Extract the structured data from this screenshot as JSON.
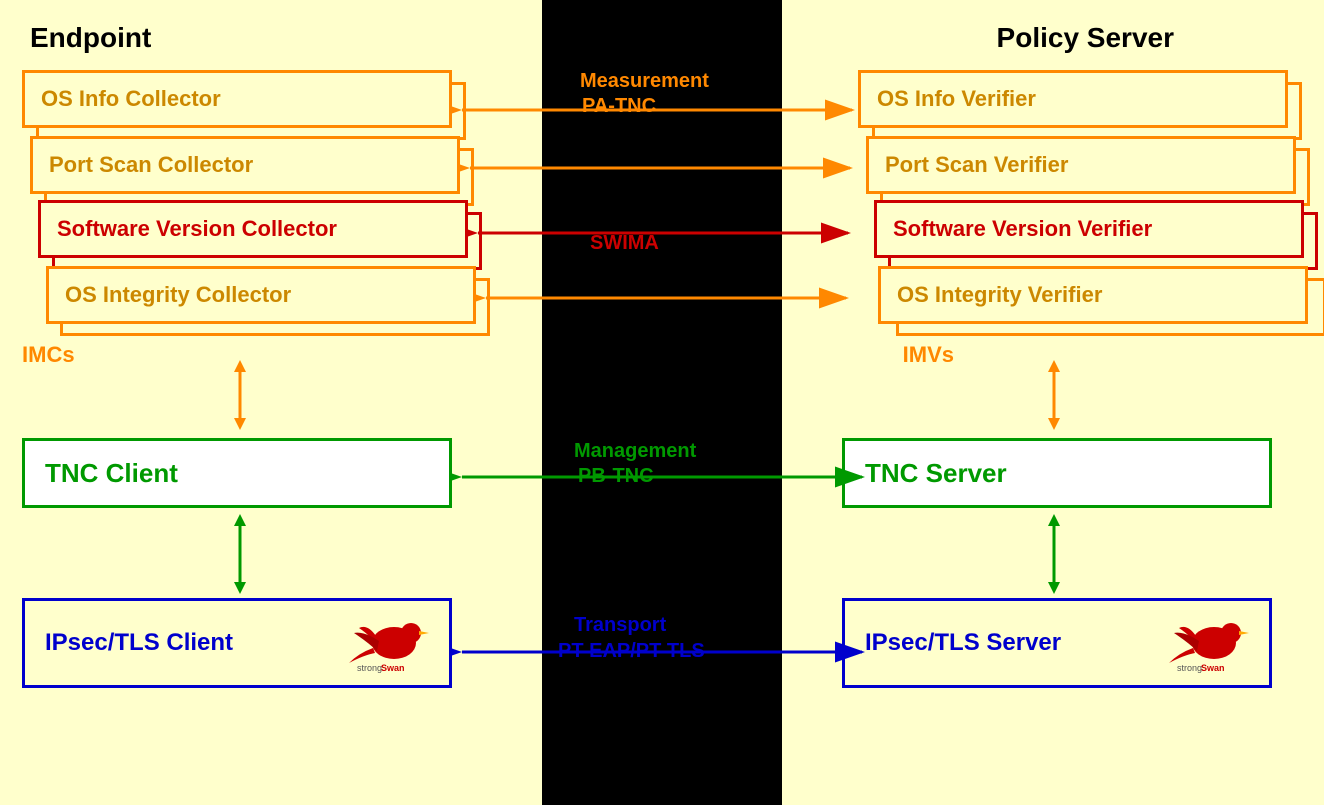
{
  "diagram": {
    "title_left": "Endpoint",
    "title_right": "Policy Server",
    "collectors": {
      "os_info": "OS Info Collector",
      "port_scan": "Port Scan Collector",
      "software_version": "Software Version Collector",
      "os_integrity": "OS Integrity Collector"
    },
    "verifiers": {
      "os_info": "OS Info Verifier",
      "port_scan": "Port Scan Verifier",
      "software_version": "Software Version Verifier",
      "os_integrity": "OS Integrity Verifier"
    },
    "imc_label": "IMCs",
    "imv_label": "IMVs",
    "tnc_client": "TNC Client",
    "tnc_server": "TNC Server",
    "ipsec_client": "IPsec/TLS Client",
    "ipsec_server": "IPsec/TLS Server",
    "protocol_measurement": "Measurement",
    "protocol_pa_tnc": "PA-TNC",
    "protocol_swima": "SWIMA",
    "protocol_management": "Management",
    "protocol_pb_tnc": "PB-TNC",
    "protocol_transport": "Transport",
    "protocol_pt": "PT-EAP/PT-TLS",
    "strongswan": "strongSwan",
    "colors": {
      "orange": "#ff8800",
      "red": "#cc0000",
      "green": "#009900",
      "blue": "#0000cc",
      "bg": "#ffffcc",
      "black": "#000000"
    }
  }
}
